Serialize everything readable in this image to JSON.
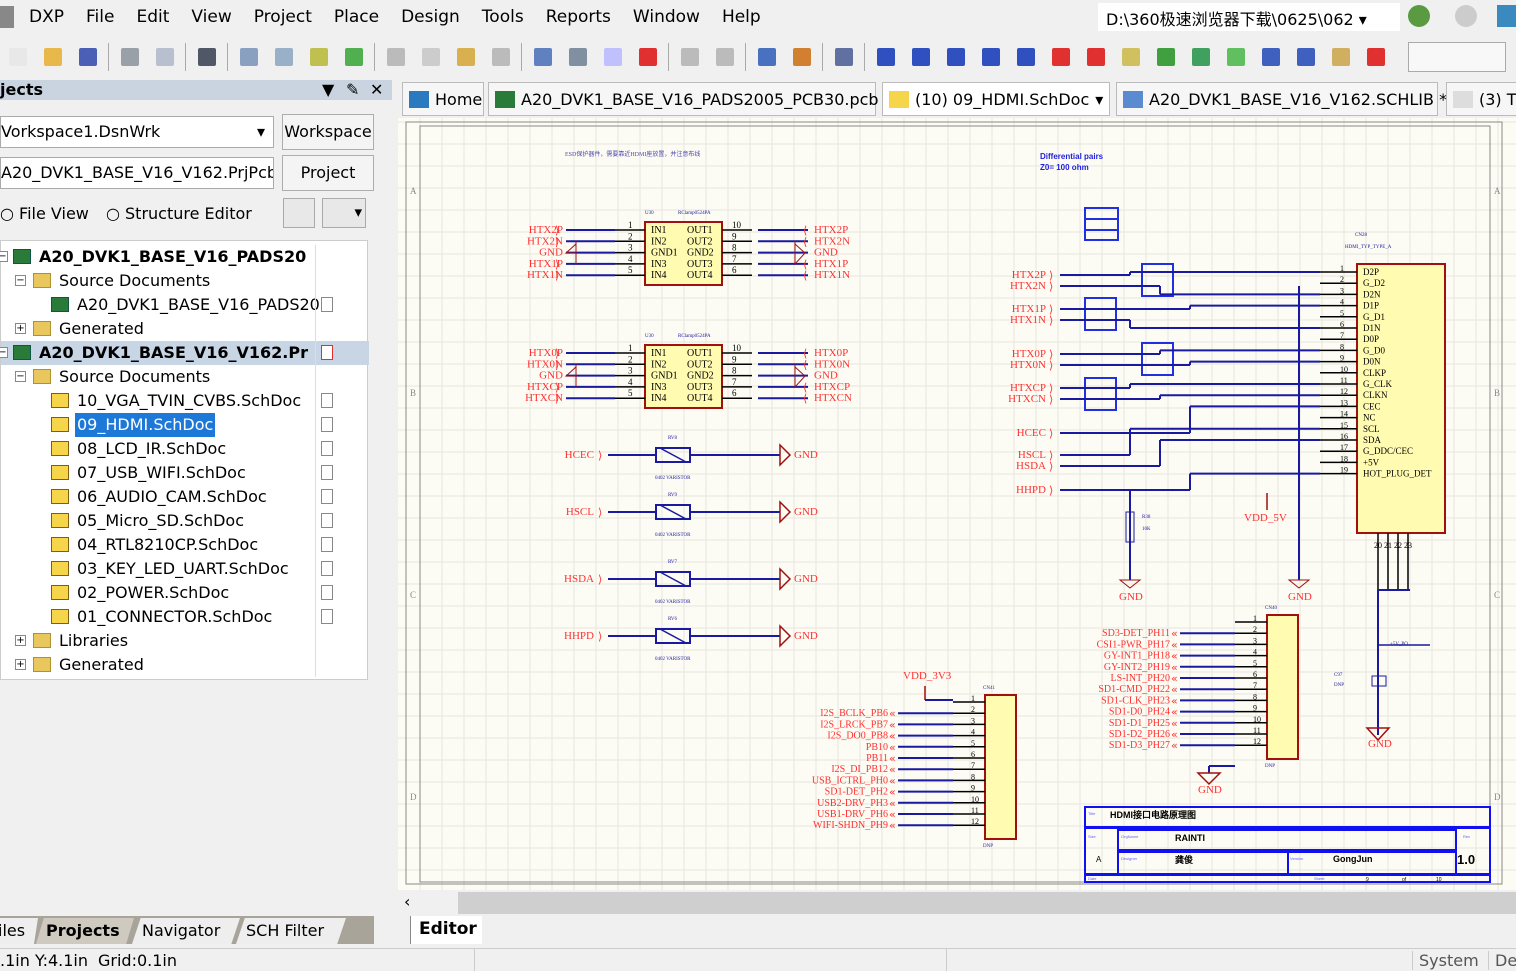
{
  "menu": {
    "items": [
      "DXP",
      "File",
      "Edit",
      "View",
      "Project",
      "Place",
      "Design",
      "Tools",
      "Reports",
      "Window",
      "Help"
    ],
    "path": "D:\\360极速浏览器下载\\0625\\062"
  },
  "toolbar": {
    "icons": [
      "new-icon",
      "open-icon",
      "save-icon",
      "|",
      "print-icon",
      "print-preview-icon",
      "|",
      "3d-icon",
      "|",
      "zoom-fit-icon",
      "zoom-area-icon",
      "zoom-selected-icon",
      "zoom-filtered-icon",
      "|",
      "cut-icon",
      "copy-icon",
      "paste-icon",
      "rubber-stamp-icon",
      "|",
      "select-area-icon",
      "move-icon",
      "cross-probe-icon",
      "clear-filter-icon",
      "|",
      "undo-icon",
      "redo-icon",
      "|",
      "hierarchy-icon",
      "browse-icon",
      "|",
      "library-icon",
      "|",
      "wire-icon",
      "bus-icon",
      "bus-entry-icon",
      "signal-harness-icon",
      "net-label-icon",
      "gnd-port-icon",
      "vcc-port-icon",
      "part-icon",
      "sheet-symbol-icon",
      "sheet-entry-icon",
      "device-sheet-icon",
      "harness-connector-icon",
      "harness-entry-icon",
      "port-icon",
      "no-erc-icon"
    ],
    "colors": [
      "#e8e8e8",
      "#e8b84a",
      "#4a5fb5",
      "|",
      "#9aa0a8",
      "#b8c0d0",
      "|",
      "#505868",
      "|",
      "#8aa0c0",
      "#9ab0c8",
      "#c0c050",
      "#50b050",
      "|",
      "#bbb",
      "#ccc",
      "#d8b050",
      "#bbb",
      "|",
      "#6080c0",
      "#8090a0",
      "#c0c0ff",
      "#e03030",
      "|",
      "#bbb",
      "#bbb",
      "|",
      "#4a70c0",
      "#d08030",
      "|",
      "#6070a0",
      "|",
      "#3050c0",
      "#3050c0",
      "#3050c0",
      "#3050c0",
      "#3050c0",
      "#e03030",
      "#e03030",
      "#d0c060",
      "#40a040",
      "#40a060",
      "#60c060",
      "#4060c0",
      "#4060c0",
      "#d0b060",
      "#e03030"
    ]
  },
  "panel": {
    "title": "jects",
    "workspace_value": "Vorkspace1.DsnWrk",
    "workspace_btn": "Workspace",
    "project_value": "A20_DVK1_BASE_V16_V162.PrjPcb",
    "project_btn": "Project",
    "radio_file": "File View",
    "radio_structure": "Structure Editor",
    "tree": [
      {
        "label": "A20_DVK1_BASE_V16_PADS20",
        "lvl": 0,
        "exp": "−",
        "icon": "pcbproj",
        "bold": true
      },
      {
        "label": "Source Documents",
        "lvl": 1,
        "exp": "−",
        "icon": "folder"
      },
      {
        "label": "A20_DVK1_BASE_V16_PADS20",
        "lvl": 2,
        "icon": "pcb",
        "doc": true
      },
      {
        "label": "Generated",
        "lvl": 1,
        "exp": "+",
        "icon": "folder"
      },
      {
        "label": "A20_DVK1_BASE_V16_V162.Pr",
        "lvl": 0,
        "exp": "−",
        "icon": "pcbproj",
        "bold": true,
        "proj": true,
        "doc": true
      },
      {
        "label": "Source Documents",
        "lvl": 1,
        "exp": "−",
        "icon": "folder"
      },
      {
        "label": "10_VGA_TVIN_CVBS.SchDoc",
        "lvl": 2,
        "icon": "sch",
        "doc": true
      },
      {
        "label": "09_HDMI.SchDoc",
        "lvl": 2,
        "icon": "sch",
        "doc": true,
        "sel": true
      },
      {
        "label": "08_LCD_IR.SchDoc",
        "lvl": 2,
        "icon": "sch",
        "doc": true
      },
      {
        "label": "07_USB_WIFI.SchDoc",
        "lvl": 2,
        "icon": "sch",
        "doc": true
      },
      {
        "label": "06_AUDIO_CAM.SchDoc",
        "lvl": 2,
        "icon": "sch",
        "doc": true
      },
      {
        "label": "05_Micro_SD.SchDoc",
        "lvl": 2,
        "icon": "sch",
        "doc": true
      },
      {
        "label": "04_RTL8210CP.SchDoc",
        "lvl": 2,
        "icon": "sch",
        "doc": true
      },
      {
        "label": "03_KEY_LED_UART.SchDoc",
        "lvl": 2,
        "icon": "sch",
        "doc": true
      },
      {
        "label": "02_POWER.SchDoc",
        "lvl": 2,
        "icon": "sch",
        "doc": true
      },
      {
        "label": "01_CONNECTOR.SchDoc",
        "lvl": 2,
        "icon": "sch",
        "doc": true
      },
      {
        "label": "Libraries",
        "lvl": 1,
        "exp": "+",
        "icon": "folder"
      },
      {
        "label": "Generated",
        "lvl": 1,
        "exp": "+",
        "icon": "folder"
      }
    ]
  },
  "doc_tabs": [
    {
      "label": "Home",
      "icon": "home-icon",
      "color": "#2a7ac0"
    },
    {
      "label": "A20_DVK1_BASE_V16_PADS2005_PCB30.pcb",
      "icon": "pcb-icon",
      "color": "#2a7a3a"
    },
    {
      "label": "(10) 09_HDMI.SchDoc",
      "icon": "schdoc-icon",
      "color": "#f6d54a",
      "dropdown": "▾"
    },
    {
      "label": "A20_DVK1_BASE_V16_V162.SCHLIB *",
      "icon": "schlib-icon",
      "color": "#5a8ad0"
    },
    {
      "label": "(3) T",
      "icon": "text-doc-icon",
      "color": "#ddd"
    }
  ],
  "schematic": {
    "note": "ESD保护器件，需要靠近HDMI座放置，并注意布线",
    "diff_note": [
      "Differential pairs",
      "Z0= 100 ohm"
    ],
    "esd_chip": {
      "ref": "U30",
      "part": "RClamp0524PA",
      "left_pins": [
        "IN1",
        "IN2",
        "GND1",
        "IN3",
        "IN4"
      ],
      "right_pins": [
        "OUT1",
        "OUT2",
        "GND2",
        "OUT3",
        "OUT4"
      ],
      "left_nums": [
        "1",
        "2",
        "3",
        "4",
        "5"
      ],
      "right_nums": [
        "10",
        "9",
        "8",
        "7",
        "6"
      ]
    },
    "esd1_nets": [
      "HTX2P",
      "HTX2N",
      "GND",
      "HTX1P",
      "HTX1N"
    ],
    "esd2_nets": [
      "HTX0P",
      "HTX0N",
      "GND",
      "HTXCP",
      "HTXCN"
    ],
    "tvs": [
      {
        "net": "HCEC",
        "ref": "RV8"
      },
      {
        "net": "HSCL",
        "ref": "RV9"
      },
      {
        "net": "HSDA",
        "ref": "RV7"
      },
      {
        "net": "HHPD",
        "ref": "RV6"
      }
    ],
    "tvs_part": "0402 VARISTOR",
    "gnd": "GND",
    "hdmi": {
      "ref": "CN28",
      "part": "HDMI_TYP_TYPE_A",
      "pins": [
        "D2P",
        "G_D2",
        "D2N",
        "D1P",
        "G_D1",
        "D1N",
        "D0P",
        "G_D0",
        "D0N",
        "CLKP",
        "G_CLK",
        "CLKN",
        "CEC",
        "NC",
        "SCL",
        "SDA",
        "G_DDC/CEC",
        "+5V",
        "HOT_PLUG_DET"
      ],
      "extra_pins": [
        "20",
        "21",
        "22",
        "23"
      ]
    },
    "hdmi_nets": [
      [
        "HTX2P",
        1
      ],
      [
        "HTX2N",
        3
      ],
      [
        "HTX1P",
        4
      ],
      [
        "HTX1N",
        6
      ],
      [
        "HTX0P",
        8
      ],
      [
        "HTX0N",
        9
      ],
      [
        "HTXCP",
        11
      ],
      [
        "HTXCN",
        12
      ],
      [
        "HCEC",
        13
      ],
      [
        "HSCL",
        15
      ],
      [
        "HSDA",
        16
      ],
      [
        "HHPD",
        19
      ]
    ],
    "vdd5": "VDD_5V",
    "vdd33": "VDD_3V3",
    "r_ref": "R38",
    "r_val": "10K",
    "cap_ref": "C97",
    "cap_val": "DNP",
    "usbpo": "+5V_PO",
    "cn_right": {
      "ref": "CN40",
      "dnp": "DNP",
      "nets": [
        "",
        "SD3-DET_PH11",
        "CSI1-PWR_PH17",
        "GY-INT1_PH18",
        "GY-INT2_PH19",
        "LS-INT_PH20",
        "SD1-CMD_PH22",
        "SD1-CLK_PH23",
        "SD1-D0_PH24",
        "SD1-D1_PH25",
        "SD1-D2_PH26",
        "SD1-D3_PH27"
      ]
    },
    "cn_left": {
      "ref": "CN41",
      "dnp": "DNP",
      "nets": [
        "",
        "I2S_BCLK_PB6",
        "I2S_LRCK_PB7",
        "I2S_DO0_PB8",
        "PB10",
        "PB11",
        "I2S_DI_PB12",
        "USB_ICTRL_PH0",
        "SD1-DET_PH2",
        "USB2-DRV_PH3",
        "USB1-DRV_PH6",
        "WIFI-SHDN_PH9"
      ]
    },
    "title_block": {
      "title_lbl": "Title",
      "title": "HDMI接口电路原理图",
      "size_lbl": "Size",
      "size": "A",
      "org_lbl": "OrgName",
      "org": "RAINTI",
      "rev_lbl": "Rev",
      "rev": "1.0",
      "designer_lbl": "Designer",
      "designer": "龚俊",
      "version_lbl": "Version",
      "version": "GongJun",
      "date_lbl": "Date",
      "sheet_lbl": "Sheet",
      "sheet": "9",
      "of": "of",
      "total": "10"
    },
    "zones_left": [
      "A",
      "B",
      "C",
      "D"
    ],
    "colors": {
      "wire": "#1a1aa0",
      "net": "#ff3030",
      "body": "#fffbb0",
      "body_border": "#a01010",
      "grid": "#e6e6de",
      "pin": "#000"
    }
  },
  "bottom_tabs": [
    "iles",
    "Projects",
    "Navigator",
    "SCH Filter"
  ],
  "editor_tab": "Editor",
  "status": {
    "coords": ".1in Y:4.1in",
    "grid": "Grid:0.1in",
    "system": "System",
    "de": "De"
  }
}
